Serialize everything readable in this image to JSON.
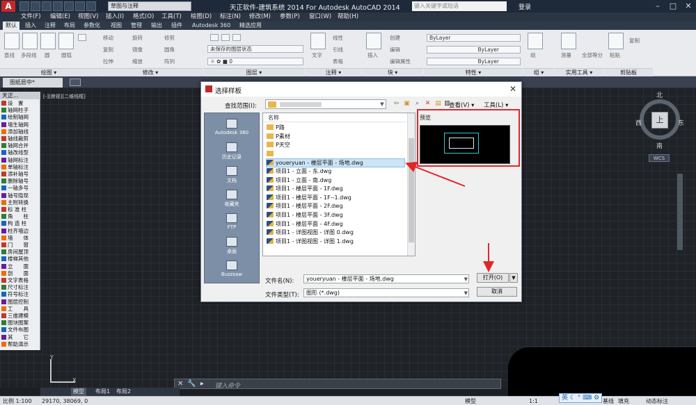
{
  "app": {
    "title": "天正软件-建筑系统 2014  For Autodesk AutoCAD 2014",
    "logo": "A",
    "workspace": "草图与注释",
    "search_placeholder": "键入关键字或短语",
    "login": "登录"
  },
  "menu": [
    "文件(F)",
    "编辑(E)",
    "视图(V)",
    "插入(I)",
    "格式(O)",
    "工具(T)",
    "绘图(D)",
    "标注(N)",
    "修改(M)",
    "参数(P)",
    "窗口(W)",
    "帮助(H)"
  ],
  "ribbon_tabs": [
    "默认",
    "插入",
    "注释",
    "布局",
    "参数化",
    "视图",
    "管理",
    "输出",
    "插件",
    "Autodesk 360",
    "精选应用"
  ],
  "ribbon": {
    "draw_items": [
      "直线",
      "多段线",
      "圆",
      "圆弧"
    ],
    "modify_items": [
      "移动",
      "旋转",
      "修剪",
      "复制",
      "镜像",
      "圆角",
      "拉伸",
      "缩放",
      "阵列"
    ],
    "layer_state": "未保存的图层状态",
    "layer_value": "0",
    "annotation_items": [
      "文字",
      "线性",
      "引线",
      "表格"
    ],
    "block_items": [
      "插入",
      "创建",
      "编辑",
      "编辑属性"
    ],
    "props": [
      "ByLayer",
      "ByLayer",
      "ByLayer"
    ],
    "group_items": [
      "组"
    ],
    "util_items": [
      "测量",
      "全部等分"
    ],
    "clip_items": [
      "粘贴",
      "复制"
    ],
    "panels": [
      "绘图 ▾",
      "修改 ▾",
      "图层 ▾",
      "注释 ▾",
      "块 ▾",
      "特性 ▾",
      "组 ▾",
      "实用工具 ▾",
      "剪贴板"
    ]
  },
  "doc_tab": "图纸居中*",
  "canvas_label": "[-][俯视][二维线框]",
  "sidebar": {
    "title": "天正...",
    "items": [
      "设　置",
      "轴网柱子",
      "绘制轴网",
      "墙生轴网",
      "添加轴线",
      "轴线裁剪",
      "轴网合并",
      "轴改线型",
      "轴网标注",
      "单轴标注",
      "添补轴号",
      "删除轴号",
      "一轴多号",
      "轴号隐现",
      "主附转换",
      "标 准 柱",
      "角　　柱",
      "构 造 柱",
      "柱齐墙边",
      "墙　　体",
      "门　　窗",
      "房间屋顶",
      "楼梯其他",
      "立　　面",
      "剖　　面",
      "文字表格",
      "尺寸标注",
      "符号标注",
      "图层控制",
      "工　　具",
      "三维建模",
      "图块图案",
      "文件布图",
      "其　　它",
      "帮助演示"
    ]
  },
  "compass": {
    "n": "北",
    "s": "南",
    "e": "东",
    "w": "西",
    "center": "上",
    "wcs": "WCS"
  },
  "ucs": {
    "y": "Y",
    "x": "X"
  },
  "command_placeholder": "键入命令",
  "layout_tabs": [
    "模型",
    "布局1",
    "布局2"
  ],
  "status": {
    "coords": "29170, 38069, 0",
    "scale": "比例 1:100",
    "right": [
      "模型",
      "1:1",
      "基线",
      "填充",
      "动态标注"
    ],
    "ime": "英"
  },
  "dialog": {
    "title": "选择样板",
    "lookin_label": "查找范围(I):",
    "view_label": "查看(V)",
    "tools_label": "工具(L)",
    "places": [
      "Autodesk 360",
      "历史记录",
      "文档",
      "收藏夹",
      "FTP",
      "桌面",
      "Buzzsaw"
    ],
    "name_header": "名称",
    "files": [
      {
        "name": "P路",
        "type": "folder"
      },
      {
        "name": "P素材",
        "type": "folder"
      },
      {
        "name": "P天空",
        "type": "folder"
      },
      {
        "name": "",
        "type": "folder"
      },
      {
        "name": "youeryuan - 楼层平面 - 场地.dwg",
        "type": "dwg",
        "selected": true
      },
      {
        "name": "项目1 - 立面 - 东.dwg",
        "type": "dwg"
      },
      {
        "name": "项目1 - 立面 - 南.dwg",
        "type": "dwg"
      },
      {
        "name": "项目1 - 楼层平面 - 1F.dwg",
        "type": "dwg"
      },
      {
        "name": "项目1 - 楼层平面 - 1F--1.dwg",
        "type": "dwg"
      },
      {
        "name": "项目1 - 楼层平面 - 2F.dwg",
        "type": "dwg"
      },
      {
        "name": "项目1 - 楼层平面 - 3F.dwg",
        "type": "dwg"
      },
      {
        "name": "项目1 - 楼层平面 - 4F.dwg",
        "type": "dwg"
      },
      {
        "name": "项目1 - 详图视图 - 详图 0.dwg",
        "type": "dwg"
      },
      {
        "name": "项目1 - 详图视图 - 详图 1.dwg",
        "type": "dwg"
      }
    ],
    "preview_label": "预览",
    "filename_label": "文件名(N):",
    "filename_value": "youeryuan - 楼层平面 - 场地.dwg",
    "filetype_label": "文件类型(T):",
    "filetype_value": "图形 (*.dwg)",
    "open_label": "打开(O)",
    "cancel_label": "取消"
  },
  "colors": {
    "highlight_red": "#e0262a",
    "accent_blue": "#cce4f7"
  }
}
